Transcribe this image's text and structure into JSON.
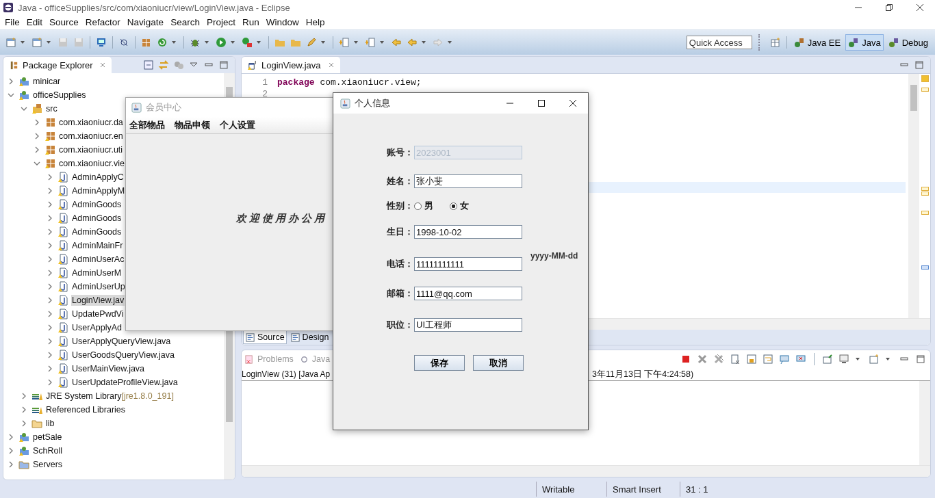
{
  "window": {
    "title": "Java - officeSupplies/src/com/xiaoniucr/view/LoginView.java - Eclipse"
  },
  "menu": [
    "File",
    "Edit",
    "Source",
    "Refactor",
    "Navigate",
    "Search",
    "Project",
    "Run",
    "Window",
    "Help"
  ],
  "quick_access": {
    "placeholder": "Quick Access"
  },
  "perspectives": [
    {
      "label": "Java EE",
      "selected": false
    },
    {
      "label": "Java",
      "selected": true
    },
    {
      "label": "Debug",
      "selected": false
    }
  ],
  "package_explorer": {
    "title": "Package Explorer",
    "tree": [
      {
        "label": "minicar",
        "kind": "project",
        "expanded": false,
        "selected": false
      },
      {
        "label": "officeSupplies",
        "kind": "project",
        "expanded": true,
        "selected": false,
        "children": [
          {
            "label": "src",
            "kind": "source-folder",
            "expanded": true,
            "selected": false,
            "children": [
              {
                "label": "com.xiaoniucr.da",
                "kind": "package",
                "expanded": false,
                "selected": false
              },
              {
                "label": "com.xiaoniucr.en",
                "kind": "package",
                "expanded": false,
                "selected": false
              },
              {
                "label": "com.xiaoniucr.uti",
                "kind": "package",
                "expanded": false,
                "selected": false
              },
              {
                "label": "com.xiaoniucr.vie",
                "kind": "package",
                "expanded": true,
                "selected": false,
                "children": [
                  {
                    "label": "AdminApplyC",
                    "kind": "java",
                    "expanded": false,
                    "selected": false
                  },
                  {
                    "label": "AdminApplyM",
                    "kind": "java",
                    "expanded": false,
                    "selected": false
                  },
                  {
                    "label": "AdminGoods",
                    "kind": "java",
                    "expanded": false,
                    "selected": false
                  },
                  {
                    "label": "AdminGoods",
                    "kind": "java",
                    "expanded": false,
                    "selected": false
                  },
                  {
                    "label": "AdminGoods",
                    "kind": "java",
                    "expanded": false,
                    "selected": false
                  },
                  {
                    "label": "AdminMainFr",
                    "kind": "java",
                    "expanded": false,
                    "selected": false
                  },
                  {
                    "label": "AdminUserAc",
                    "kind": "java",
                    "expanded": false,
                    "selected": false
                  },
                  {
                    "label": "AdminUserM",
                    "kind": "java",
                    "expanded": false,
                    "selected": false
                  },
                  {
                    "label": "AdminUserUp",
                    "kind": "java",
                    "expanded": false,
                    "selected": false
                  },
                  {
                    "label": "LoginView.jav",
                    "kind": "java",
                    "expanded": false,
                    "selected": true
                  },
                  {
                    "label": "UpdatePwdVi",
                    "kind": "java",
                    "expanded": false,
                    "selected": false
                  },
                  {
                    "label": "UserApplyAd",
                    "kind": "java",
                    "expanded": false,
                    "selected": false
                  },
                  {
                    "label": "UserApplyQueryView.java",
                    "kind": "java",
                    "expanded": false,
                    "selected": false
                  },
                  {
                    "label": "UserGoodsQueryView.java",
                    "kind": "java",
                    "expanded": false,
                    "selected": false
                  },
                  {
                    "label": "UserMainView.java",
                    "kind": "java",
                    "expanded": false,
                    "selected": false
                  },
                  {
                    "label": "UserUpdateProfileView.java",
                    "kind": "java",
                    "expanded": false,
                    "selected": false
                  }
                ]
              }
            ]
          },
          {
            "label": "JRE System Library",
            "suffix": "[jre1.8.0_191]",
            "kind": "library",
            "expanded": false,
            "selected": false
          },
          {
            "label": "Referenced Libraries",
            "kind": "library",
            "expanded": false,
            "selected": false
          },
          {
            "label": "lib",
            "kind": "folder",
            "expanded": false,
            "selected": false
          }
        ]
      },
      {
        "label": "petSale",
        "kind": "project",
        "expanded": false,
        "selected": false
      },
      {
        "label": "SchRoll",
        "kind": "project",
        "expanded": false,
        "selected": false
      },
      {
        "label": "Servers",
        "kind": "folder",
        "expanded": false,
        "selected": false
      }
    ]
  },
  "editor": {
    "tab": "LoginView.java",
    "lines": [
      {
        "number": "1",
        "tokens": [
          {
            "kind": "keyword",
            "text": "package"
          },
          {
            "kind": "plain",
            "text": " com.xiaoniucr.view;"
          }
        ]
      },
      {
        "number": "2"
      }
    ]
  },
  "editor_tabs": [
    {
      "label": "Source",
      "selected": true
    },
    {
      "label": "Design",
      "selected": false
    }
  ],
  "console": {
    "tabs": [
      {
        "label": "Problems",
        "selected": false
      },
      {
        "label": "Java",
        "selected": false
      }
    ],
    "header_left": "LoginView (31) [Java Ap",
    "header_right": "3年11月13日 下午4:24:58)"
  },
  "status_bar": [
    "Writable",
    "Smart Insert",
    "31 : 1"
  ],
  "member_window": {
    "title": "会员中心",
    "menu": [
      "全部物品",
      "物品申领",
      "个人设置"
    ],
    "welcome": "欢迎使用办公用"
  },
  "dialog": {
    "title": "个人信息",
    "fields": [
      {
        "kind": "text",
        "label": "账号：",
        "value": "2023001",
        "disabled": true
      },
      {
        "kind": "text",
        "label": "姓名：",
        "value": "张小斐",
        "disabled": false
      },
      {
        "kind": "radio",
        "label": "性别：",
        "disabled": false,
        "options": [
          {
            "label": "男",
            "selected": false
          },
          {
            "label": "女",
            "selected": true
          }
        ]
      },
      {
        "kind": "text",
        "label": "生日：",
        "value": "1998-10-02",
        "disabled": false
      },
      {
        "kind": "text",
        "label": "电话：",
        "value": "11111111111",
        "disabled": false,
        "hint": "yyyy-MM-dd"
      },
      {
        "kind": "text",
        "label": "邮箱：",
        "value": "1111@qq.com",
        "disabled": false
      },
      {
        "kind": "text",
        "label": "职位：",
        "value": "UI工程师",
        "disabled": false
      }
    ],
    "buttons": [
      "保存",
      "取消"
    ]
  }
}
